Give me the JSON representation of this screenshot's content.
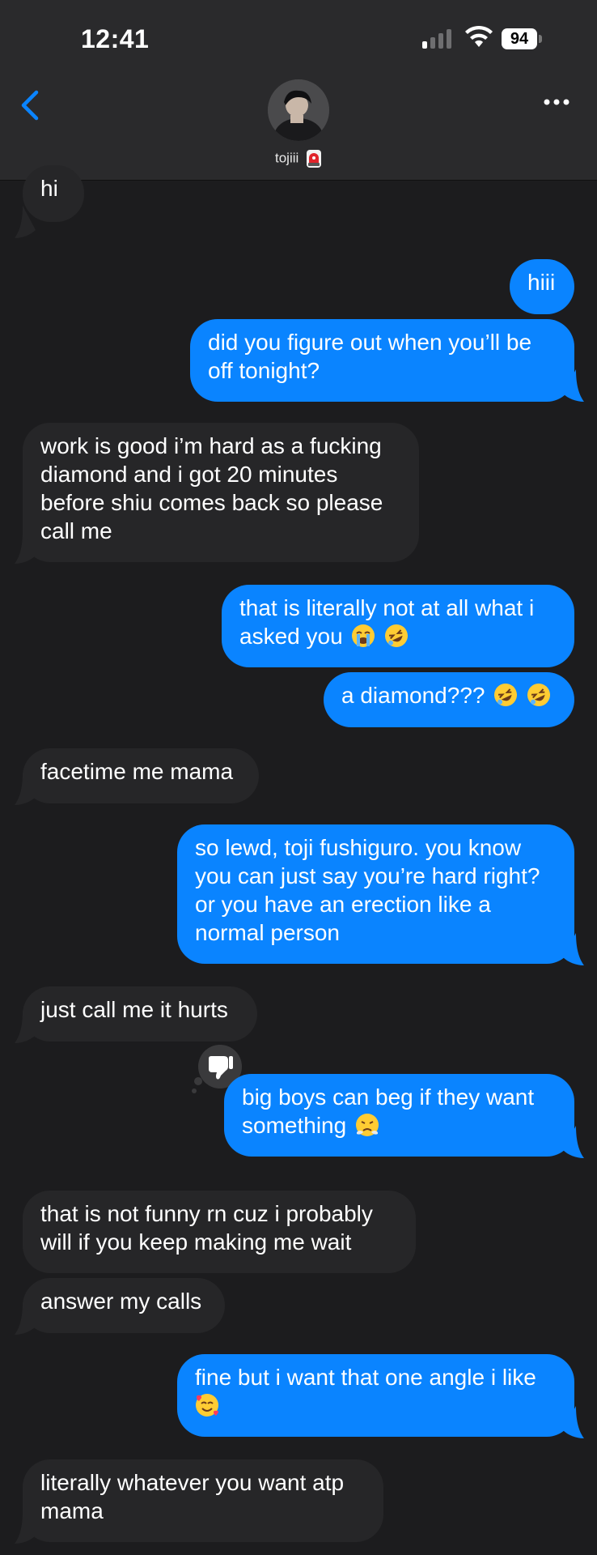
{
  "status_bar": {
    "time": "12:41",
    "battery": "94"
  },
  "contact": {
    "name": "tojiii"
  },
  "messages": [
    {
      "side": "in",
      "text": "hi"
    },
    {
      "side": "out",
      "text": "hiii"
    },
    {
      "side": "out",
      "text": "did you figure out when you’ll be off tonight?"
    },
    {
      "side": "in",
      "text": "work is good i’m hard as a fucking diamond and i got 20 minutes before shiu comes back so please call me"
    },
    {
      "side": "out",
      "text": "that is literally not at all what i asked you"
    },
    {
      "side": "out",
      "text": "a diamond???"
    },
    {
      "side": "in",
      "text": "facetime me mama"
    },
    {
      "side": "out",
      "text": "so lewd, toji fushiguro. you know you can just say you’re hard right? or you have an erection like a normal person"
    },
    {
      "side": "in",
      "text": "just call me it hurts"
    },
    {
      "side": "out",
      "text": "big boys can beg if they want something",
      "reaction": "thumbs-down"
    },
    {
      "side": "in",
      "text": "that is not funny rn cuz i probably will if you keep making me wait"
    },
    {
      "side": "in",
      "text": "answer my calls"
    },
    {
      "side": "out",
      "text": "fine but i want that one angle i like"
    },
    {
      "side": "in",
      "text": "literally whatever you want atp mama"
    }
  ],
  "colors": {
    "background": "#1c1c1e",
    "incoming": "#262628",
    "outgoing": "#0a84ff",
    "accent": "#0a84ff"
  }
}
